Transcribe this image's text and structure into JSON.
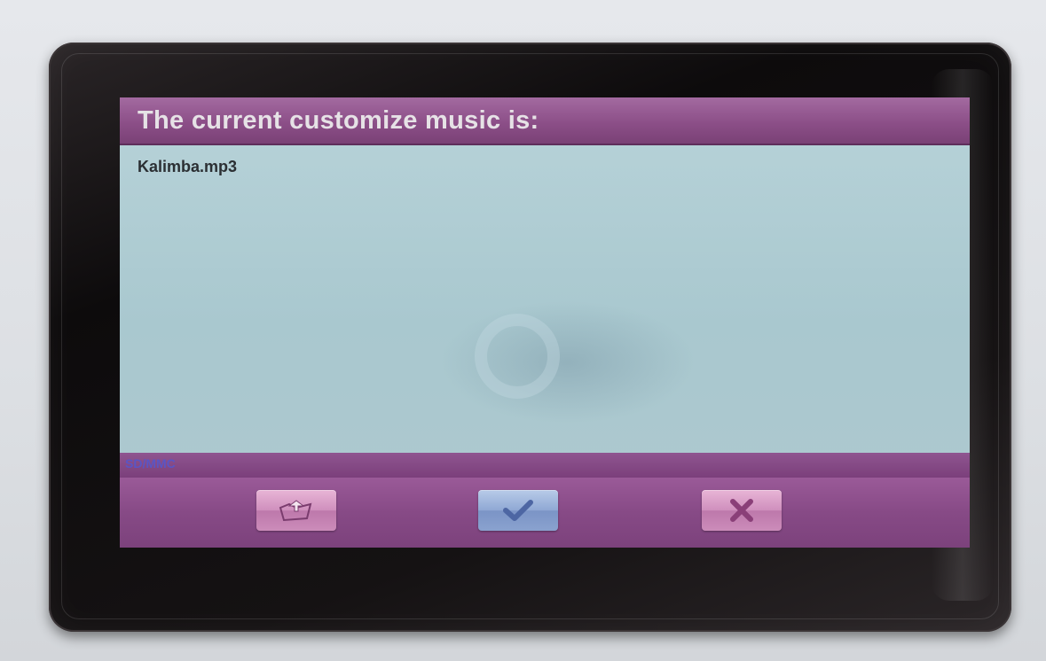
{
  "dialog": {
    "title": "The current customize music is:",
    "current_file": "Kalimba.mp3"
  },
  "status_bar": {
    "storage_label": "SD/MMC"
  },
  "toolbar": {
    "buttons": [
      {
        "icon": "open-folder-icon"
      },
      {
        "icon": "checkmark-icon"
      },
      {
        "icon": "close-x-icon"
      }
    ]
  },
  "colors": {
    "title_bar": "#8c4f88",
    "content_background": "#b3ced4",
    "toolbar": "#874a86",
    "button_pink": "#cf8fbd",
    "button_blue": "#8fa8d4",
    "storage_label": "#5a55c4"
  }
}
